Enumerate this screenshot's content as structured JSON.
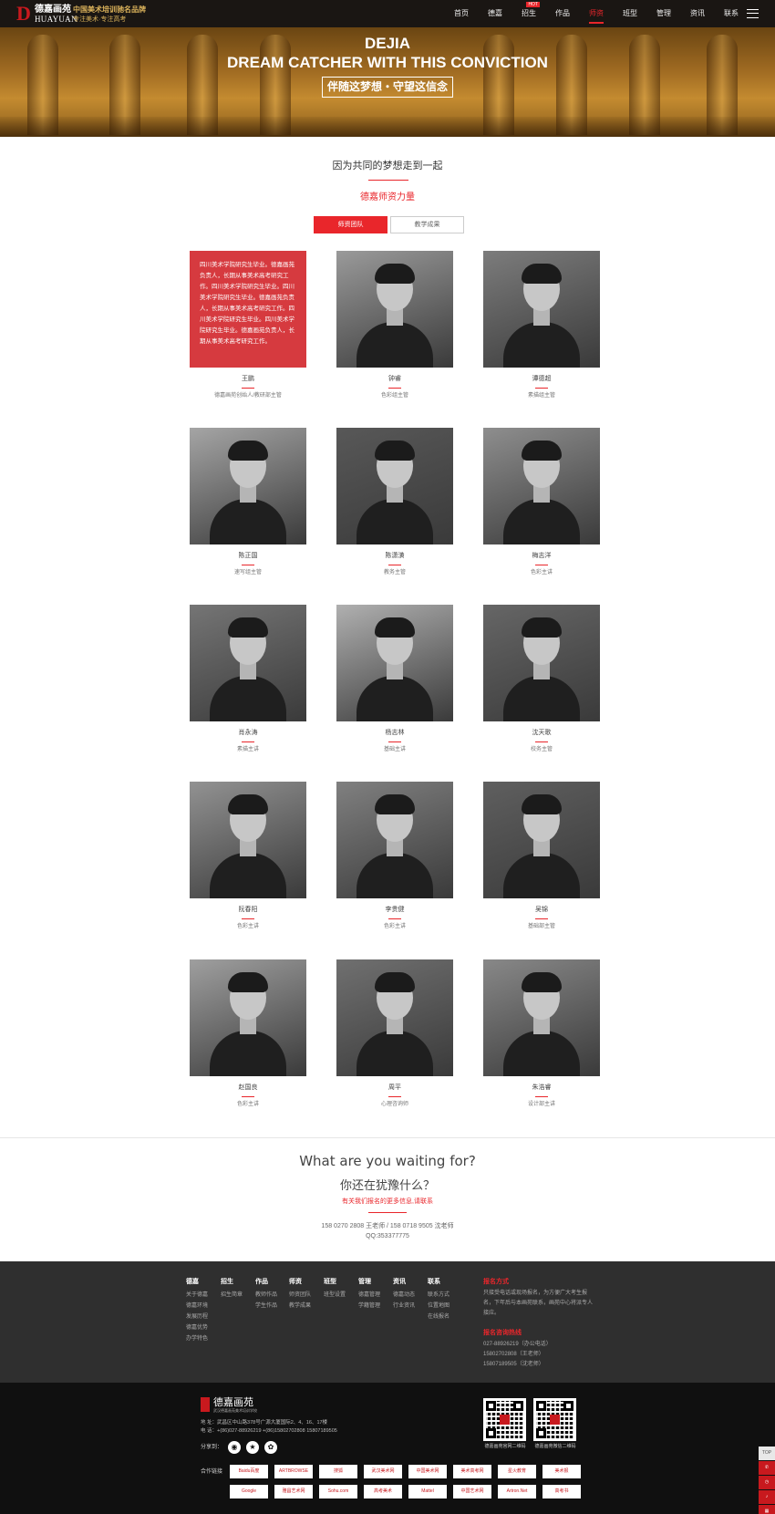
{
  "header": {
    "logo_letter": "D",
    "logo_cn": "德嘉画苑",
    "logo_en": "HUAYUAN",
    "slogan": "中国美术培训驰名品牌",
    "slogan_sub": "专注美术·专注高考",
    "nav": [
      {
        "label": "首页",
        "active": false
      },
      {
        "label": "德嘉",
        "active": false
      },
      {
        "label": "招生",
        "active": false,
        "badge": "HOT"
      },
      {
        "label": "作品",
        "active": false
      },
      {
        "label": "师资",
        "active": true
      },
      {
        "label": "班型",
        "active": false
      },
      {
        "label": "管理",
        "active": false
      },
      {
        "label": "资讯",
        "active": false
      },
      {
        "label": "联系",
        "active": false
      }
    ],
    "menu_icon": "hamburger-menu-icon"
  },
  "banner": {
    "line1": "DEJIA",
    "line2": "DREAM CATCHER WITH THIS CONVICTION",
    "cn": "伴随这梦想・守望这信念"
  },
  "section": {
    "title": "因为共同的梦想走到一起",
    "subtitle": "德嘉师资力量",
    "tabs": [
      "师资团队",
      "教学成果"
    ],
    "accent": "#e9262b"
  },
  "teachers": [
    {
      "name": "王鹏",
      "role": "德嘉画苑创始人/教研部主管",
      "bio": "四川美术学院研究生毕业。德嘉画苑负责人，长期从事美术高考研究工作。四川美术学院研究生毕业。四川美术学院研究生毕业。德嘉画苑负责人，长期从事美术高考研究工作。四川美术学院研究生毕业。四川美术学院研究生毕业。德嘉画苑负责人，长期从事美术高考研究工作。"
    },
    {
      "name": "钟睿",
      "role": "色彩组主管"
    },
    {
      "name": "谭德超",
      "role": "素描组主管"
    },
    {
      "name": "陈正国",
      "role": "速写组主管"
    },
    {
      "name": "陈潇潢",
      "role": "教务主管"
    },
    {
      "name": "梅志洋",
      "role": "色彩主讲"
    },
    {
      "name": "肖永涛",
      "role": "素描主讲"
    },
    {
      "name": "杨志林",
      "role": "基础主讲"
    },
    {
      "name": "沈天歌",
      "role": "校务主管"
    },
    {
      "name": "阮春阳",
      "role": "色彩主讲"
    },
    {
      "name": "李贵健",
      "role": "色彩主讲"
    },
    {
      "name": "吴锦",
      "role": "基础部主管"
    },
    {
      "name": "赵国良",
      "role": "色彩主讲"
    },
    {
      "name": "周平",
      "role": "心理咨询师"
    },
    {
      "name": "朱浩睿",
      "role": "设计部主讲"
    }
  ],
  "cta": {
    "en": "What are you waiting for?",
    "cn": "你还在犹豫什么？",
    "red": "有关我们报名的更多信息,请联系",
    "phones": "158 0270 2808 王老师 / 158 0718 9505 沈老师",
    "qq": "QQ:353377775"
  },
  "footer": {
    "columns": [
      {
        "head": "德嘉",
        "items": [
          "关于德嘉",
          "德嘉环境",
          "发展历程",
          "德嘉优势",
          "办学特色"
        ]
      },
      {
        "head": "招生",
        "items": [
          "招生简章"
        ]
      },
      {
        "head": "作品",
        "items": [
          "教师作品",
          "学生作品"
        ]
      },
      {
        "head": "师资",
        "items": [
          "师资团队",
          "教学成果"
        ]
      },
      {
        "head": "班型",
        "items": [
          "班型设置"
        ]
      },
      {
        "head": "管理",
        "items": [
          "德嘉管理",
          "学籍管理"
        ]
      },
      {
        "head": "资讯",
        "items": [
          "德嘉动态",
          "行业资讯"
        ]
      },
      {
        "head": "联系",
        "items": [
          "联系方式",
          "位置地图",
          "在线报名"
        ]
      }
    ],
    "signup_head": "报名方式",
    "signup_text": "只接受电话或现场报名，为方便广大考生报名，下年后与本画苑联系，画苑中心将派专人接应。",
    "hotline_head": "报名咨询热线",
    "hotlines": [
      "027-88926219（办公电话）",
      "15802702808（王老师）",
      "15807189505（沈老师）"
    ]
  },
  "bottom": {
    "logo_cn": "德嘉画苑",
    "logo_sub": "武汉德嘉画苑美术培训学校",
    "address": "地  址：武昌区中山路378号广源大厦国际2、4、16、17楼",
    "phone": "电  话：+(86)027-88926219 +(86)15802702808 15807189505",
    "share_label": "分享到：",
    "share_icons": [
      "weibo-icon",
      "star-icon",
      "wechat-icon"
    ],
    "links_label": "合作链接",
    "partners": [
      "Baidu百度",
      "ARTBROWSE",
      "搜狐",
      "武汉美术网",
      "中国美术网",
      "美术高考网",
      "星火教育",
      "美术报",
      "Google",
      "雅昌艺术网",
      "Sohu.com",
      "高考美术",
      "Mattel",
      "中国艺术网",
      "Artron.Net",
      "高考书"
    ],
    "qr_captions": [
      "德嘉画苑官网二维码",
      "德嘉画苑微信二维码"
    ]
  },
  "side": {
    "top": "TOP"
  }
}
